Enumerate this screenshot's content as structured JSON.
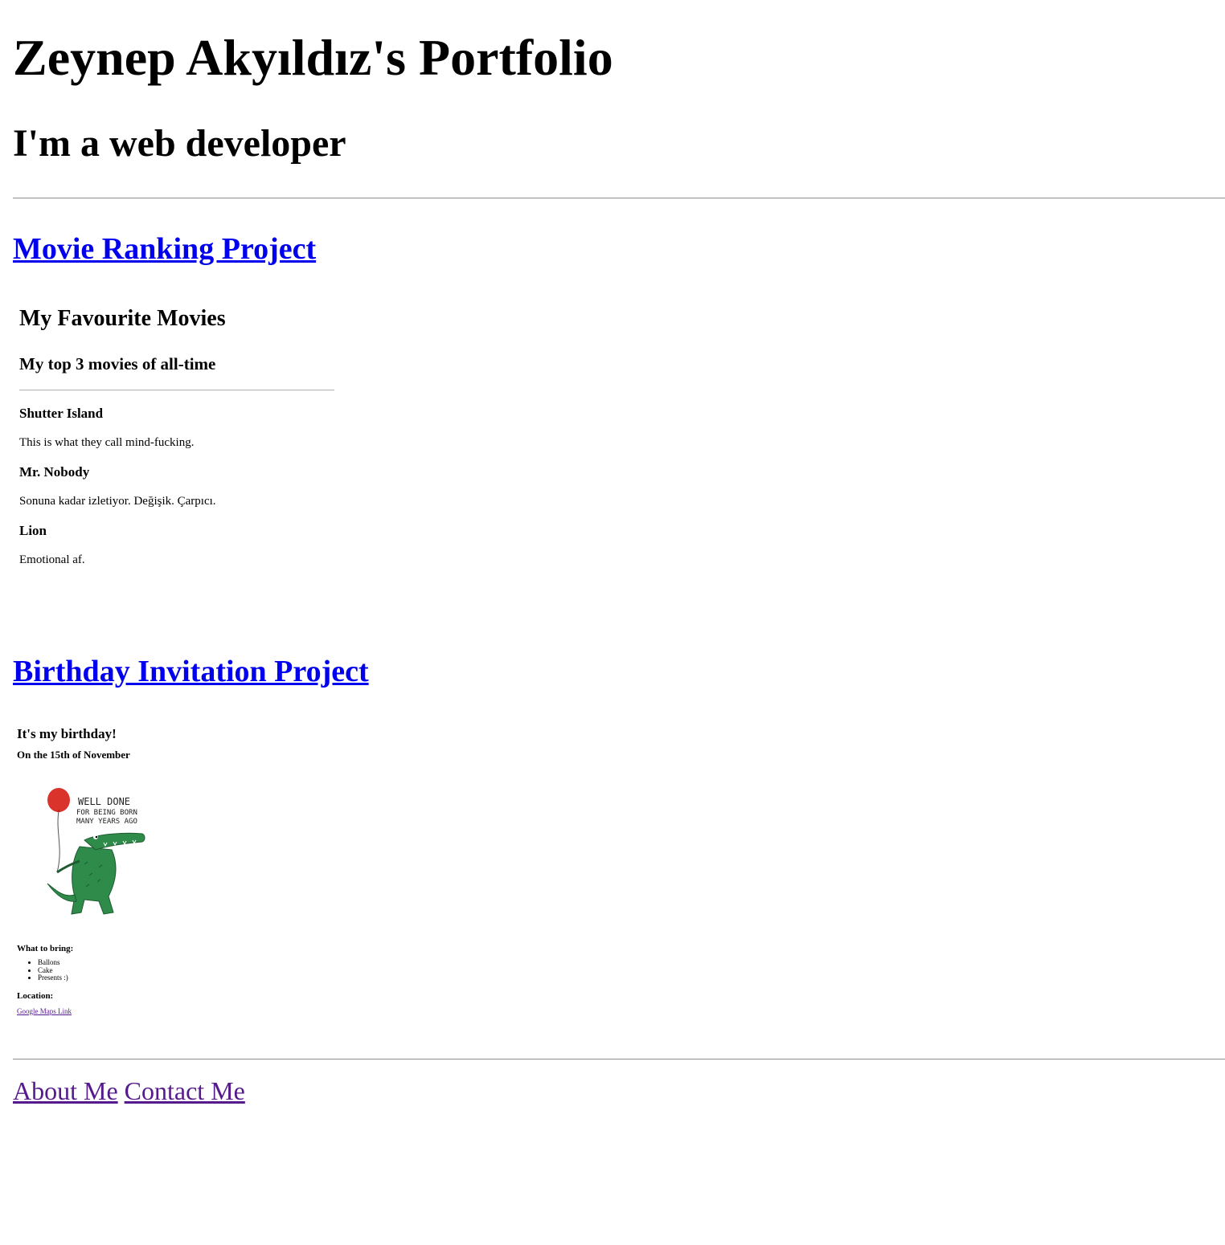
{
  "header": {
    "title": "Zeynep Akyıldız's Portfolio",
    "subtitle": "I'm a web developer"
  },
  "projects": {
    "movie": {
      "link_label": "Movie Ranking Project",
      "heading": "My Favourite Movies",
      "subheading": "My top 3 movies of all-time",
      "movies": [
        {
          "title": "Shutter Island",
          "desc": "This is what they call mind-fucking."
        },
        {
          "title": "Mr. Nobody",
          "desc": "Sonuna kadar izletiyor. Değişik. Çarpıcı."
        },
        {
          "title": "Lion",
          "desc": "Emotional af."
        }
      ]
    },
    "birthday": {
      "link_label": "Birthday Invitation Project",
      "heading": "It's my birthday!",
      "date": "On the 15th of November",
      "image_caption": [
        "WELL DONE",
        "FOR BEING BORN",
        "MANY YEARS AGO"
      ],
      "bring_label": "What to bring:",
      "bring_items": [
        "Ballons",
        "Cake",
        "Presents :)"
      ],
      "location_label": "Location:",
      "maps_link": "Google Maps Link"
    }
  },
  "footer": {
    "about": "About Me",
    "contact": "Contact Me"
  },
  "colors": {
    "link_unvisited": "#0000ee",
    "link_visited": "#551a8b",
    "croc_green": "#2e8b4a",
    "balloon_red": "#d9332b"
  }
}
